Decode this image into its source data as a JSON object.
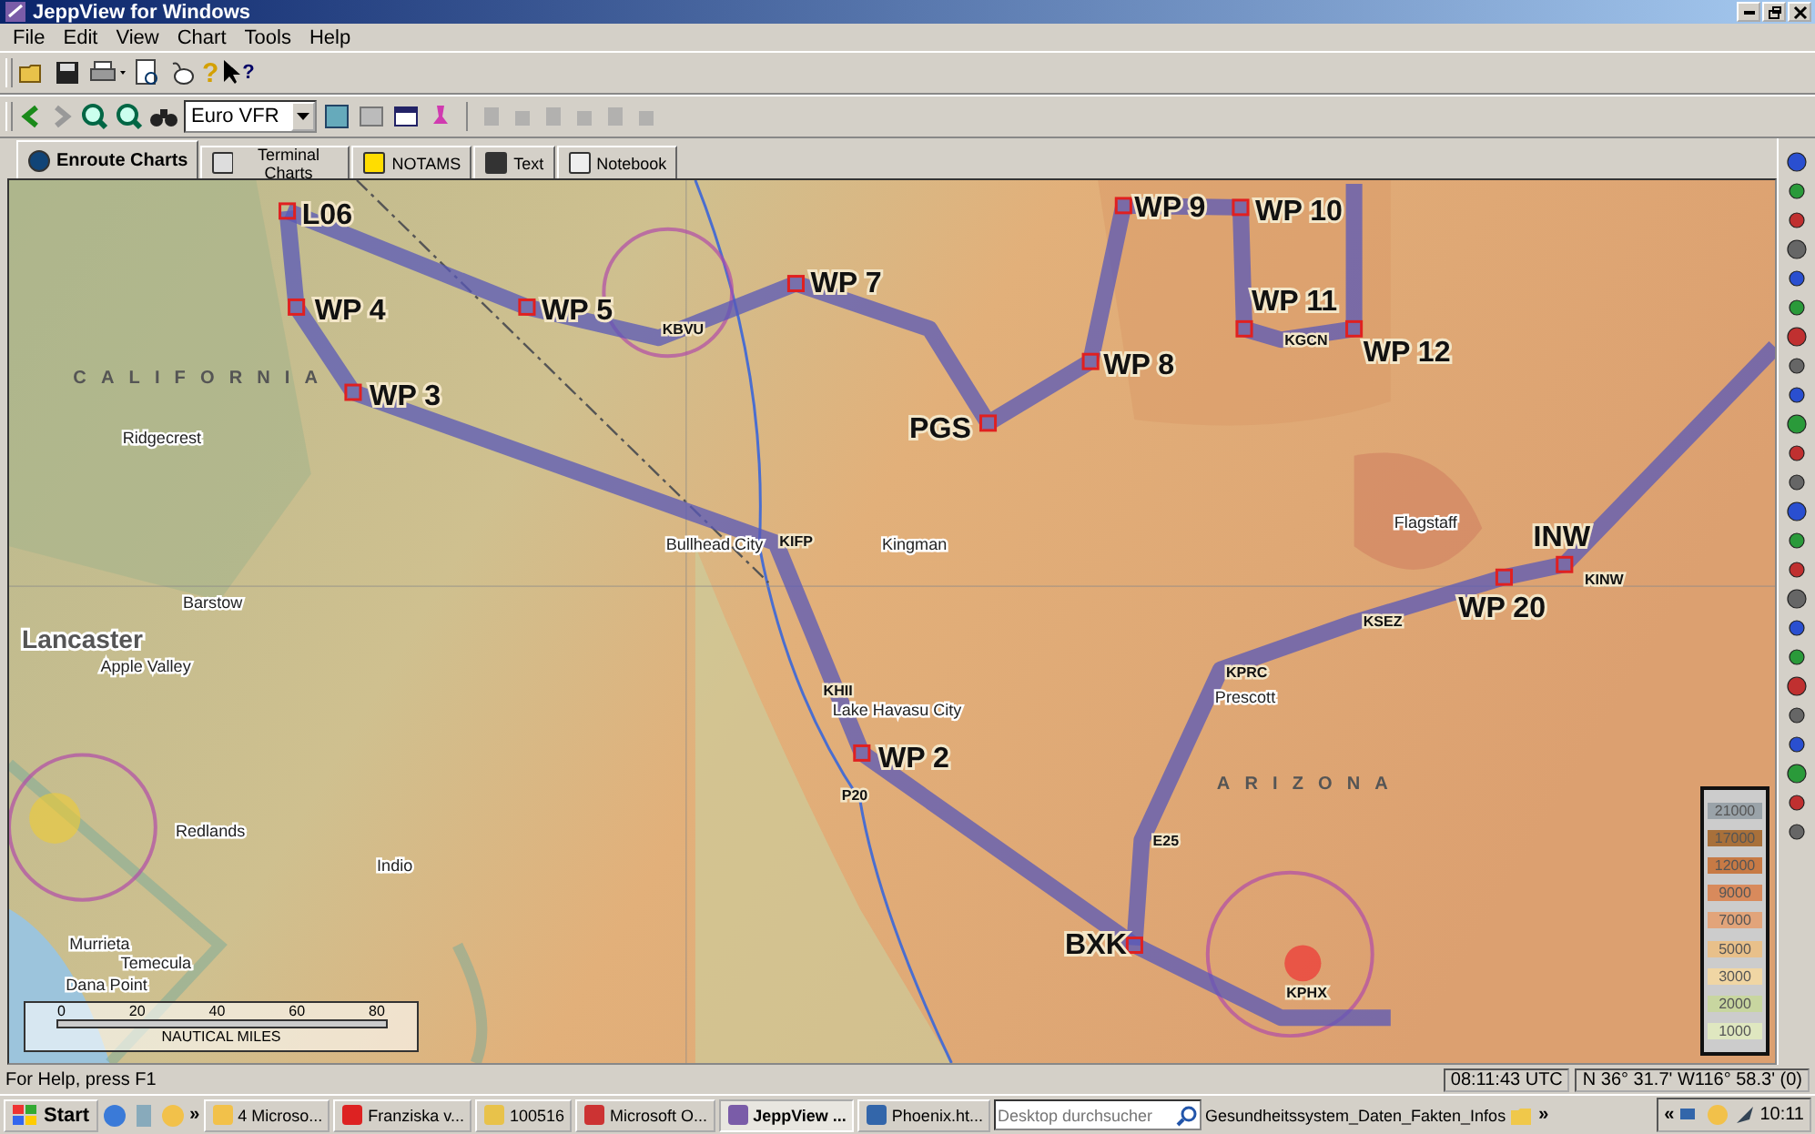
{
  "window": {
    "title": "JeppView for Windows"
  },
  "menu": [
    "File",
    "Edit",
    "View",
    "Chart",
    "Tools",
    "Help"
  ],
  "toolbar": {
    "help_glyph": "?",
    "context_help_glyph": "?"
  },
  "chart_selector": {
    "value": "Euro VFR"
  },
  "tabs": [
    {
      "label": "Enroute Charts",
      "selected": true
    },
    {
      "label": "Terminal Charts",
      "selected": false
    },
    {
      "label": "NOTAMS",
      "selected": false
    },
    {
      "label": "Text",
      "selected": false
    },
    {
      "label": "Notebook",
      "selected": false
    }
  ],
  "map": {
    "waypoints": [
      {
        "label": "L06"
      },
      {
        "label": "WP 4"
      },
      {
        "label": "WP 3"
      },
      {
        "label": "WP 5"
      },
      {
        "label": "WP 7"
      },
      {
        "label": "WP 9"
      },
      {
        "label": "WP 10"
      },
      {
        "label": "WP 11"
      },
      {
        "label": "WP 12"
      },
      {
        "label": "WP 8"
      },
      {
        "label": "PGS"
      },
      {
        "label": "INW"
      },
      {
        "label": "WP 20"
      },
      {
        "label": "WP 2"
      },
      {
        "label": "BXK"
      }
    ],
    "places": [
      {
        "label": "Lancaster"
      },
      {
        "label": "Apple Valley"
      },
      {
        "label": "Barstow"
      },
      {
        "label": "Ridgecrest"
      },
      {
        "label": "Kingman"
      },
      {
        "label": "Bullhead City"
      },
      {
        "label": "Lake Havasu City"
      },
      {
        "label": "Flagstaff"
      },
      {
        "label": "Prescott"
      },
      {
        "label": "Redlands"
      },
      {
        "label": "Indio"
      },
      {
        "label": "Temecula"
      },
      {
        "label": "Murrieta"
      },
      {
        "label": "Dana Point"
      }
    ],
    "airports": [
      {
        "label": "KIFP"
      },
      {
        "label": "KBVU"
      },
      {
        "label": "KGCN"
      },
      {
        "label": "KPRC"
      },
      {
        "label": "KSEZ"
      },
      {
        "label": "KINW"
      },
      {
        "label": "E25"
      },
      {
        "label": "KPHX"
      },
      {
        "label": "KHII"
      },
      {
        "label": "P20"
      }
    ],
    "state_labels": [
      "CALIFORNIA",
      "ARIZONA"
    ],
    "scale_bar": {
      "ticks": [
        "0",
        "20",
        "40",
        "60",
        "80"
      ],
      "unit": "NAUTICAL MILES"
    },
    "elevation_legend": [
      "21000",
      "17000",
      "12000",
      "9000",
      "7000",
      "5000",
      "3000",
      "2000",
      "1000"
    ]
  },
  "status_bar": {
    "help": "For Help, press F1",
    "time": "08:11:43 UTC",
    "position": "N 36° 31.7' W116° 58.3' (0)"
  },
  "taskbar": {
    "start": "Start",
    "chevron": "»",
    "buttons": [
      {
        "label": "4 Microso...",
        "selected": false
      },
      {
        "label": "Franziska v...",
        "selected": false
      },
      {
        "label": "100516",
        "selected": false
      },
      {
        "label": "Microsoft O...",
        "selected": false
      },
      {
        "label": "JeppView ...",
        "selected": true
      },
      {
        "label": "Phoenix.ht...",
        "selected": false
      }
    ],
    "search": {
      "placeholder": "Desktop durchsucher"
    },
    "toolbar_label": "Gesundheitssystem_Daten_Fakten_Infos",
    "tray_chevron": "«",
    "clock": "10:11"
  }
}
